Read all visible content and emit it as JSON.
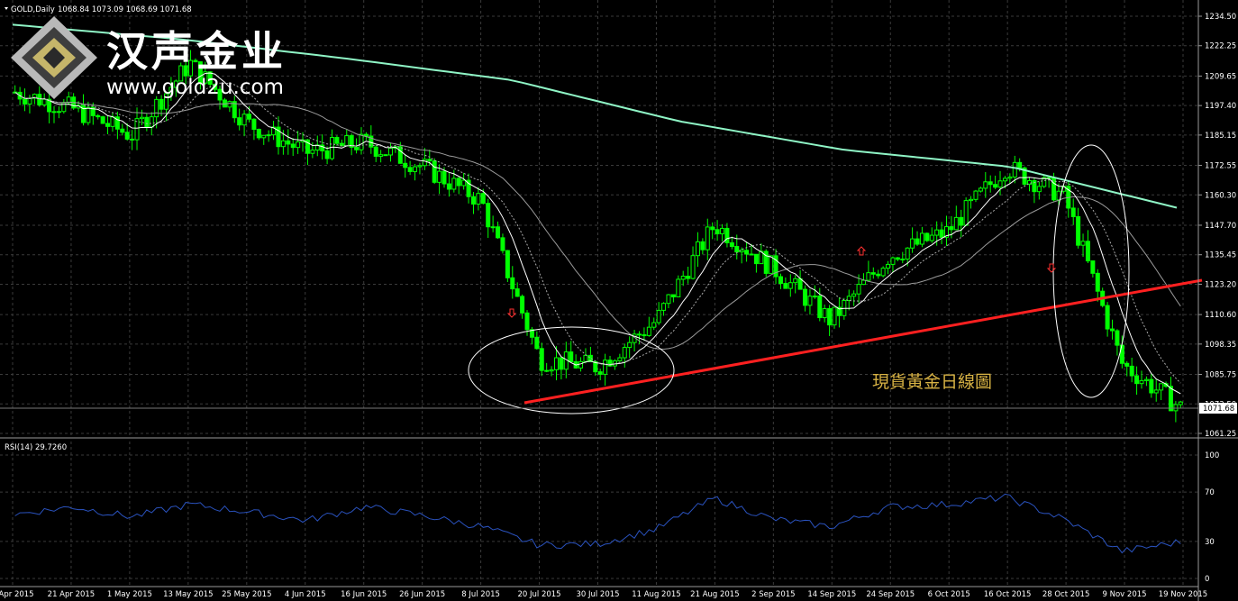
{
  "header": {
    "symbol_label": "GOLD,Daily",
    "ohlc": "1068.84 1073.09 1068.69 1071.68"
  },
  "brand": {
    "name": "汉声金业",
    "url": "www.gold2u.com"
  },
  "annotation": "現貨黃金日線圖",
  "rsi_label": "RSI(14) 29.7260",
  "price_tag": "1071.68",
  "colors": {
    "background": "#000000",
    "bull_candle": "#00ff00",
    "ma_long": "#8ff5c6",
    "ma_short": "#ffffff",
    "trendline": "#ff2020",
    "rsi": "#2a52be",
    "grid": "#3a3a3a"
  },
  "chart_data": [
    {
      "type": "line",
      "title": "GOLD,Daily",
      "price_axis_ticks": [
        "1234.50",
        "1222.25",
        "1209.65",
        "1197.40",
        "1185.15",
        "1172.55",
        "1160.30",
        "1147.70",
        "1135.45",
        "1123.20",
        "1110.60",
        "1098.35",
        "1085.75",
        "1073.50",
        "1061.25"
      ],
      "date_axis_ticks": [
        "9 Apr 2015",
        "21 Apr 2015",
        "1 May 2015",
        "13 May 2015",
        "25 May 2015",
        "4 Jun 2015",
        "16 Jun 2015",
        "26 Jun 2015",
        "8 Jul 2015",
        "20 Jul 2015",
        "30 Jul 2015",
        "11 Aug 2015",
        "21 Aug 2015",
        "2 Sep 2015",
        "14 Sep 2015",
        "24 Sep 2015",
        "6 Oct 2015",
        "16 Oct 2015",
        "28 Oct 2015",
        "9 Nov 2015",
        "19 Nov 2015"
      ],
      "ylim": [
        1061.25,
        1234.5
      ],
      "grid": true,
      "series": [
        {
          "name": "",
          "kind": "close",
          "x": [
            "9 Apr 2015",
            "21 Apr 2015",
            "1 May 2015",
            "13 May 2015",
            "25 May 2015",
            "4 Jun 2015",
            "16 Jun 2015",
            "26 Jun 2015",
            "8 Jul 2015",
            "20 Jul 2015",
            "30 Jul 2015",
            "11 Aug 2015",
            "21 Aug 2015",
            "2 Sep 2015",
            "14 Sep 2015",
            "24 Sep 2015",
            "6 Oct 2015",
            "16 Oct 2015",
            "28 Oct 2015",
            "9 Nov 2015",
            "19 Nov 2015"
          ],
          "values": [
            1203,
            1196,
            1185,
            1215,
            1190,
            1178,
            1182,
            1172,
            1158,
            1092,
            1089,
            1108,
            1148,
            1130,
            1108,
            1135,
            1145,
            1172,
            1160,
            1090,
            1072
          ]
        },
        {
          "name": "",
          "kind": "ma_long",
          "x": [
            "9 Apr 2015",
            "1 May 2015",
            "4 Jun 2015",
            "8 Jul 2015",
            "11 Aug 2015",
            "14 Sep 2015",
            "16 Oct 2015",
            "19 Nov 2015"
          ],
          "values": [
            1231,
            1225,
            1217,
            1208,
            1191,
            1179,
            1172,
            1155
          ]
        }
      ]
    },
    {
      "type": "line",
      "title": "RSI(14) 29.7260",
      "ylim": [
        0,
        100
      ],
      "y_ticks": [
        "100",
        "70",
        "30",
        "0"
      ],
      "series": [
        {
          "name": "",
          "x": [
            "9 Apr 2015",
            "21 Apr 2015",
            "1 May 2015",
            "13 May 2015",
            "25 May 2015",
            "4 Jun 2015",
            "16 Jun 2015",
            "26 Jun 2015",
            "8 Jul 2015",
            "20 Jul 2015",
            "30 Jul 2015",
            "11 Aug 2015",
            "21 Aug 2015",
            "2 Sep 2015",
            "14 Sep 2015",
            "24 Sep 2015",
            "6 Oct 2015",
            "16 Oct 2015",
            "28 Oct 2015",
            "9 Nov 2015",
            "19 Nov 2015"
          ],
          "values": [
            52,
            58,
            50,
            60,
            54,
            47,
            58,
            51,
            42,
            27,
            28,
            40,
            65,
            48,
            42,
            58,
            60,
            66,
            48,
            22,
            29.7
          ]
        }
      ]
    }
  ]
}
